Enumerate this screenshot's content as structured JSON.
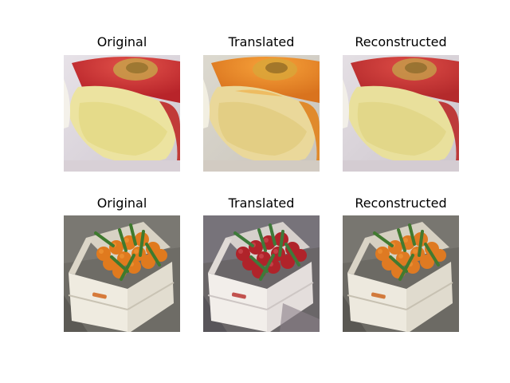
{
  "figure": {
    "rows": [
      {
        "subject": "apple-core",
        "panels": [
          {
            "title": "Original",
            "variant": "original"
          },
          {
            "title": "Translated",
            "variant": "translated"
          },
          {
            "title": "Reconstructed",
            "variant": "reconstructed"
          }
        ]
      },
      {
        "subject": "crate-of-oranges",
        "panels": [
          {
            "title": "Original",
            "variant": "original"
          },
          {
            "title": "Translated",
            "variant": "translated"
          },
          {
            "title": "Reconstructed",
            "variant": "reconstructed"
          }
        ]
      }
    ],
    "colors": {
      "background": "#ffffff",
      "apple_skin": "#c8322e",
      "apple_skin_translated": "#e88a2a",
      "apple_flesh": "#e9df8f",
      "orange_fruit": "#e0781e",
      "orange_fruit_translated": "#b0232a",
      "leaf": "#3e7a2e",
      "crate_wood": "#ece8dc",
      "floor": "#6e6c66"
    }
  }
}
